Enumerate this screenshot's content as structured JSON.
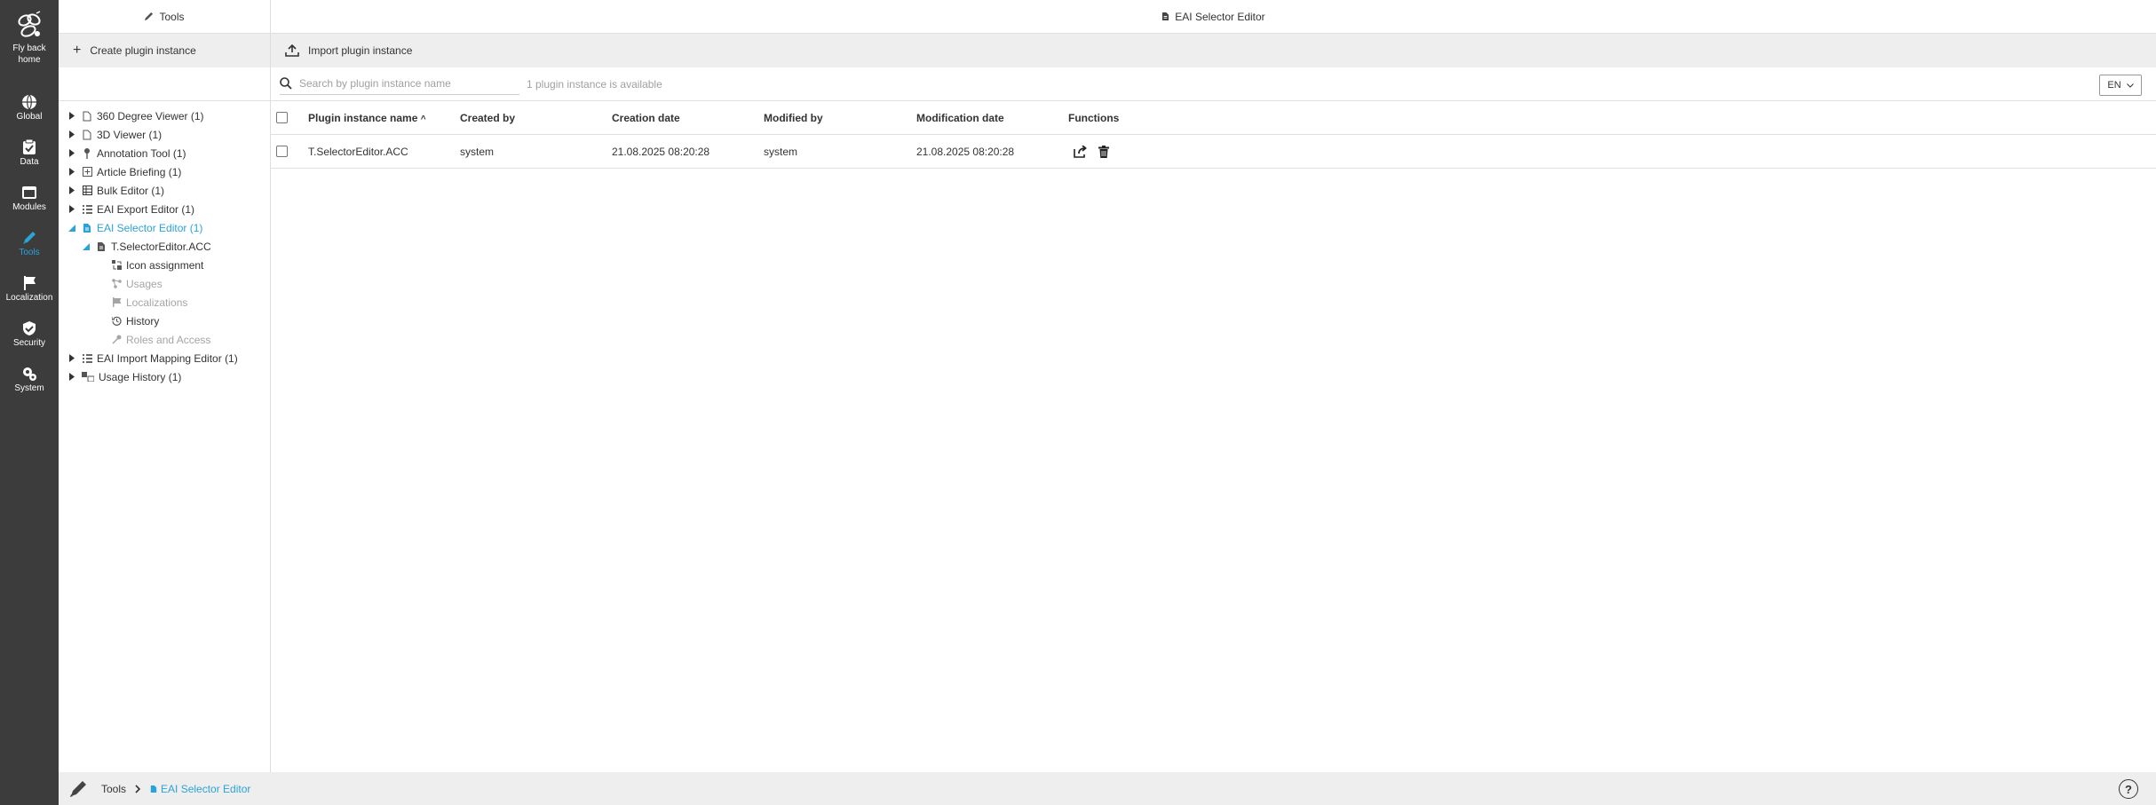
{
  "nav": {
    "home_label_1": "Fly back",
    "home_label_2": "home",
    "items": [
      {
        "label": "Global",
        "icon": "globe-icon"
      },
      {
        "label": "Data",
        "icon": "clipboard-check-icon"
      },
      {
        "label": "Modules",
        "icon": "window-icon"
      },
      {
        "label": "Tools",
        "icon": "pencil-icon"
      },
      {
        "label": "Localization",
        "icon": "flag-icon"
      },
      {
        "label": "Security",
        "icon": "shield-check-icon"
      },
      {
        "label": "System",
        "icon": "gears-icon"
      }
    ],
    "active_color": "#2aa3d8"
  },
  "tree_panel": {
    "title": "Tools",
    "create_label": "Create plugin instance",
    "items": [
      {
        "label": "360 Degree Viewer (1)"
      },
      {
        "label": "3D Viewer (1)"
      },
      {
        "label": "Annotation Tool (1)"
      },
      {
        "label": "Article Briefing (1)"
      },
      {
        "label": "Bulk Editor (1)"
      },
      {
        "label": "EAI Export Editor (1)"
      },
      {
        "label": "EAI Selector Editor (1)"
      },
      {
        "label": "T.SelectorEditor.ACC"
      },
      {
        "label": "Icon assignment"
      },
      {
        "label": "Usages"
      },
      {
        "label": "Localizations"
      },
      {
        "label": "History"
      },
      {
        "label": "Roles and Access"
      },
      {
        "label": "EAI Import Mapping Editor (1)"
      },
      {
        "label": "Usage History (1)"
      }
    ]
  },
  "main": {
    "title": "EAI Selector Editor",
    "import_label": "Import plugin instance",
    "search_placeholder": "Search by plugin instance name",
    "available_text": "1 plugin instance is available",
    "language": "EN",
    "columns": [
      "Plugin instance name",
      "Created by",
      "Creation date",
      "Modified by",
      "Modification date",
      "Functions"
    ],
    "sort_indicator": "^",
    "rows": [
      {
        "name": "T.SelectorEditor.ACC",
        "created_by": "system",
        "creation_date": "21.08.2025 08:20:28",
        "modified_by": "system",
        "modification_date": "21.08.2025 08:20:28"
      }
    ]
  },
  "footer": {
    "crumb_root": "Tools",
    "crumb_current": "EAI Selector Editor",
    "help": "?"
  }
}
